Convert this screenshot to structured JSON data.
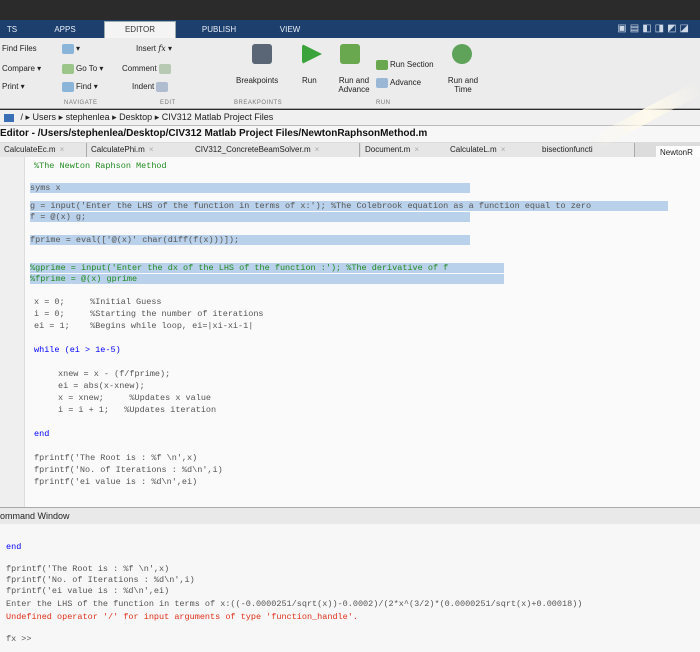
{
  "ribbon_tabs": [
    "TS",
    "APPS",
    "EDITOR",
    "PUBLISH",
    "VIEW"
  ],
  "ribbon": {
    "find_files": "Find Files",
    "compare": "Compare",
    "print": "Print",
    "go_to": "Go To",
    "find": "Find",
    "insert": "Insert",
    "comment": "Comment",
    "indent": "Indent",
    "breakpoints": "Breakpoints",
    "run": "Run",
    "run_and_advance": "Run and Advance",
    "run_section": "Run Section",
    "advance": "Advance",
    "run_and_time": "Run and Time",
    "groups": [
      "NAVIGATE",
      "EDIT",
      "BREAKPOINTS",
      "RUN"
    ]
  },
  "breadcrumb": [
    "Users",
    "stephenlea",
    "Desktop",
    "CIV312 Matlab Project Files"
  ],
  "editor_title": "Editor - /Users/stephenlea/Desktop/CIV312 Matlab Project Files/NewtonRaphsonMethod.m",
  "file_tabs": [
    "CalculateEc.m",
    "CalculatePhi.m",
    "CIV312_ConcreteBeamSolver.m",
    "Document.m",
    "CalculateL.m",
    "bisectionfuncti",
    "NewtonR"
  ],
  "code": {
    "l1": "%The Newton Raphson Method",
    "l2": "syms x",
    "l3": "g = input('Enter the LHS of the function in terms of x:'); %The Colebrook equation as a function equal to zero",
    "l4": "f = @(x) g;",
    "l5": "fprime = eval(['@(x)' char(diff(f(x)))]);",
    "l6": "%gprime = input('Enter the dx of the LHS of the function :'); %The derivative of f",
    "l7": "%fprime = @(x) gprime",
    "l8": "x = 0;     %Initial Guess",
    "l9": "i = 0;     %Starting the number of iterations",
    "l10": "ei = 1;    %Begins while loop, ei=|xi-xi-1|",
    "l11": "while (ei > 1e-5)",
    "l12": "xnew = x - (f/fprime);",
    "l13": "ei = abs(x-xnew);",
    "l14": "x = xnew;     %Updates x value",
    "l15": "i = i + 1;   %Updates iteration",
    "l16": "end",
    "l17": "fprintf('The Root is : %f \\n',x)",
    "l18": "fprintf('No. of Iterations : %d\\n',i)",
    "l19": "fprintf('ei value is : %d\\n',ei)"
  },
  "command_window": {
    "title": "ommand Window",
    "lines": [
      "end",
      "fprintf('The Root is : %f \\n',x)",
      "fprintf('No. of Iterations : %d\\n',i)",
      "fprintf('ei value is : %d\\n',ei)",
      "Enter the LHS of the function in terms of x:((-0.0000251/sqrt(x))-0.0002)/(2*x^(3/2)*(0.0000251/sqrt(x)+0.00018))",
      "Undefined operator '/' for input arguments of type 'function_handle'."
    ],
    "prompt": "fx >>"
  }
}
